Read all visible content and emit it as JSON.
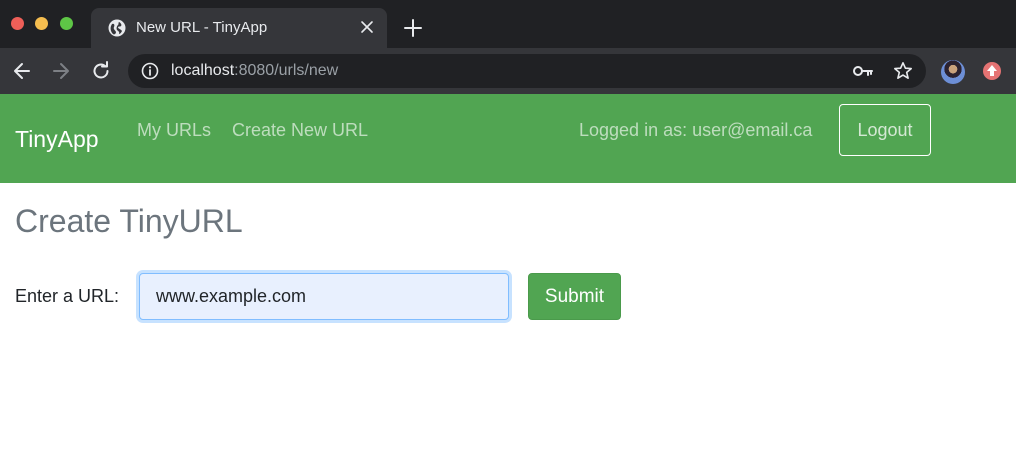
{
  "browser": {
    "tab": {
      "title": "New URL - TinyApp",
      "icon": "globe-icon"
    },
    "address_bar": {
      "host": "localhost",
      "path": ":8080/urls/new"
    },
    "icons": [
      "back-arrow-icon",
      "forward-arrow-icon",
      "reload-icon",
      "info-icon",
      "key-icon",
      "star-icon",
      "avatar",
      "extension-icon",
      "close-icon",
      "plus-icon"
    ]
  },
  "navbar": {
    "brand": "TinyApp",
    "links": [
      "My URLs",
      "Create New URL"
    ],
    "logged_in_text": "Logged in as: user@email.ca",
    "logout_label": "Logout",
    "background_color": "#51a552"
  },
  "main": {
    "title": "Create TinyURL",
    "form": {
      "label": "Enter a URL:",
      "input_value": "www.example.com",
      "submit_label": "Submit"
    }
  }
}
